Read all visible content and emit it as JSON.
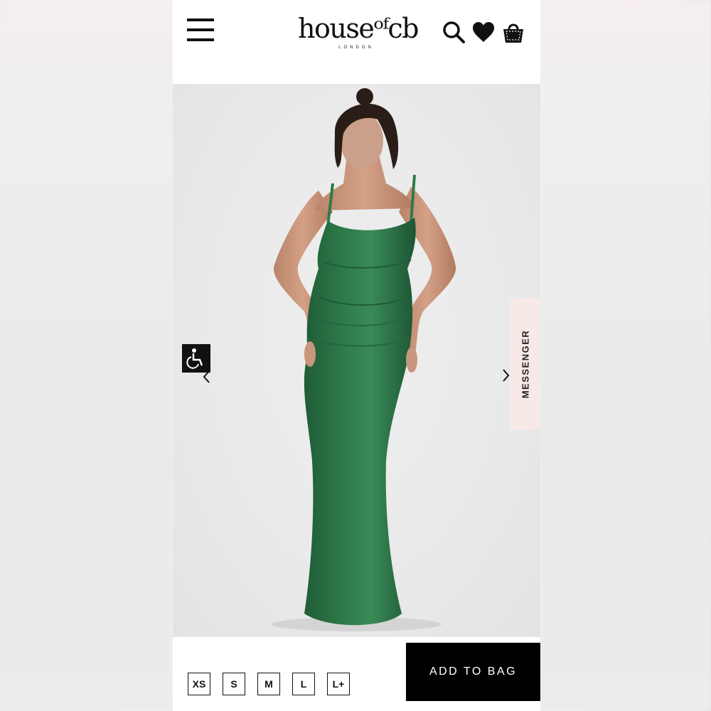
{
  "header": {
    "logo_main": "houseᵒᶠcb",
    "logo_sub": "LONDON"
  },
  "icons": [
    "menu-icon",
    "search-icon",
    "heart-icon",
    "bag-icon",
    "accessibility-icon",
    "chevron-left-icon",
    "chevron-right-icon"
  ],
  "messenger": {
    "label": "MESSENGER"
  },
  "product": {
    "dress_color": "#2f7a4a",
    "sizes": [
      "XS",
      "S",
      "M",
      "L",
      "L+"
    ]
  },
  "cta": {
    "add_to_bag": "ADD TO BAG"
  },
  "colors": {
    "primary": "#000000",
    "accent_tab": "#f7e9e6",
    "background": "#ffffff"
  }
}
